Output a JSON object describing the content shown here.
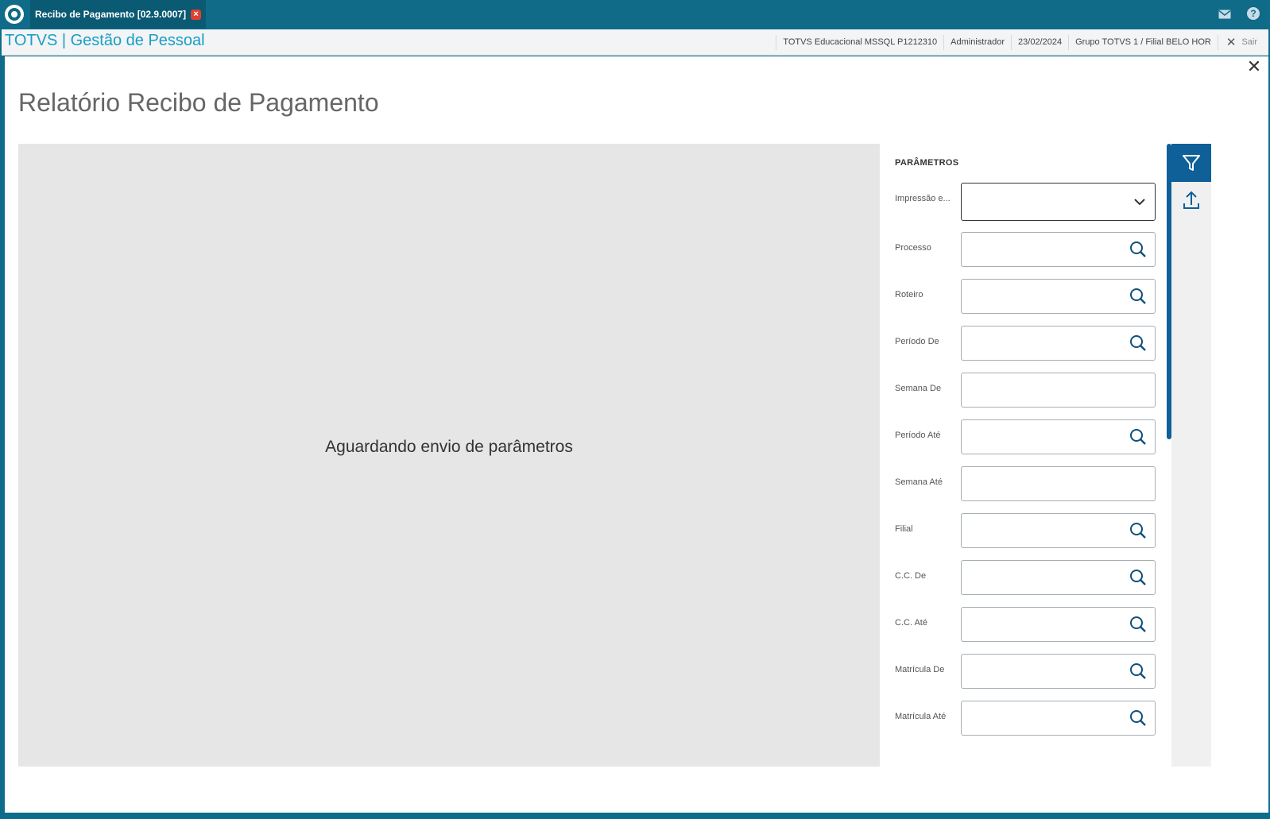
{
  "titlebar": {
    "tab_label": "Recibo de Pagamento [02.9.0007]",
    "tab_close_glyph": "×"
  },
  "header": {
    "brand": "TOTVS | Gestão de Pessoal",
    "environment": "TOTVS Educacional MSSQL P1212310",
    "user": "Administrador",
    "date": "23/02/2024",
    "branch": "Grupo TOTVS 1 / Filial BELO HOR",
    "logout_label": "Sair"
  },
  "main": {
    "close_glyph": "✕",
    "page_title": "Relatório Recibo de Pagamento",
    "waiting_message": "Aguardando envio de parâmetros"
  },
  "params": {
    "title": "PARÂMETROS",
    "fields": [
      {
        "label": "Impressão e...",
        "type": "select",
        "value": ""
      },
      {
        "label": "Processo",
        "type": "lookup",
        "value": ""
      },
      {
        "label": "Roteiro",
        "type": "lookup",
        "value": ""
      },
      {
        "label": "Período De",
        "type": "lookup",
        "value": ""
      },
      {
        "label": "Semana De",
        "type": "text",
        "value": ""
      },
      {
        "label": "Período Até",
        "type": "lookup",
        "value": ""
      },
      {
        "label": "Semana Até",
        "type": "text",
        "value": ""
      },
      {
        "label": "Filial",
        "type": "lookup",
        "value": ""
      },
      {
        "label": "C.C. De",
        "type": "lookup",
        "value": ""
      },
      {
        "label": "C.C. Até",
        "type": "lookup",
        "value": ""
      },
      {
        "label": "Matrícula De",
        "type": "lookup",
        "value": ""
      },
      {
        "label": "Matrícula Até",
        "type": "lookup",
        "value": ""
      }
    ]
  },
  "icons": {
    "app": "totvs-logo-icon",
    "mail": "mail-icon",
    "help": "help-icon",
    "filter": "filter-icon",
    "upload": "upload-icon",
    "search": "search-icon",
    "dropdown": "chevron-down-icon"
  },
  "colors": {
    "titlebar": "#0f6b88",
    "brand": "#1a9ec5",
    "accent": "#0f5f99",
    "preview_bg": "#e6e6e6",
    "tab_close": "#e0412f"
  }
}
